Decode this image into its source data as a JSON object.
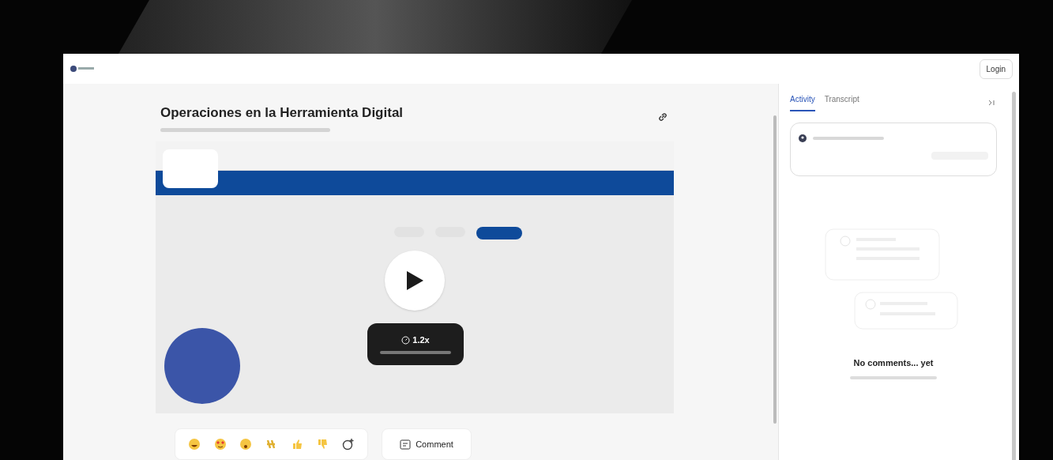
{
  "header": {
    "login": "Login"
  },
  "video": {
    "title": "Operaciones en la Herramienta Digital",
    "speed": "1.2x"
  },
  "panel": {
    "tabs": [
      {
        "label": "Activity",
        "selected": true
      },
      {
        "label": "Transcript",
        "selected": false
      }
    ],
    "empty_title": "No comments... yet"
  },
  "reactions": [
    {
      "kind": "laugh"
    },
    {
      "kind": "love"
    },
    {
      "kind": "wow"
    },
    {
      "kind": "clap"
    },
    {
      "kind": "thumbs-up"
    },
    {
      "kind": "thumbs-down"
    },
    {
      "kind": "add"
    }
  ],
  "comment_button": "Comment"
}
